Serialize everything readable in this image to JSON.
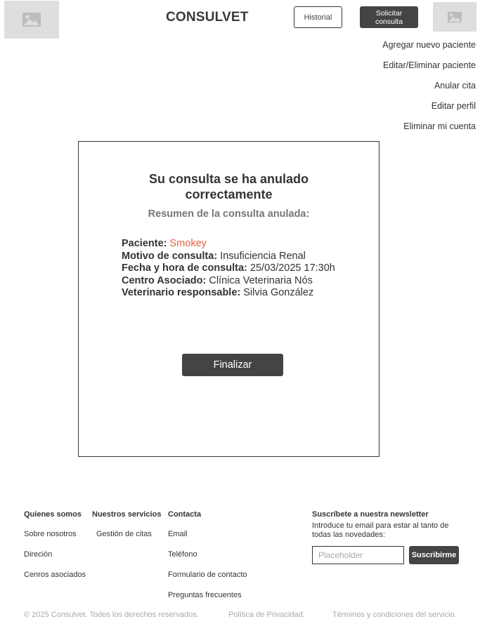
{
  "header": {
    "logo_icon": "image-placeholder-icon",
    "brand": "CONSULVET",
    "history_button": "Historial",
    "request_button": "Solicitar\nconsulta",
    "avatar_icon": "image-placeholder-icon"
  },
  "side_menu": {
    "items": [
      {
        "label": "Agregar nuevo paciente"
      },
      {
        "label": "Editar/Eliminar paciente"
      },
      {
        "label": "Anular cita"
      },
      {
        "label": "Editar perfil"
      },
      {
        "label": "Eliminar mi cuenta"
      }
    ]
  },
  "confirmation": {
    "title": "Su consulta se ha anulado correctamente",
    "subtitle": "Resumen de la consulta anulada:",
    "details": [
      {
        "label": "Paciente:",
        "value": "Smokey"
      },
      {
        "label": "Motivo de consulta:",
        "value": "Insuficiencia Renal"
      },
      {
        "label": "Fecha y hora de consulta:",
        "value": "25/03/2025 17:30h"
      },
      {
        "label": "Centro Asociado:",
        "value": "Clínica Veterinaria Nós"
      },
      {
        "label": "Veterinario responsable:",
        "value": "Silvia González"
      }
    ],
    "finish_button": "Finalizar"
  },
  "footer": {
    "about": {
      "title": "Quienes somos",
      "links": [
        "Sobre nosotros",
        "Direción",
        "Cenros asociados"
      ]
    },
    "services": {
      "title": "Nuestros servicios",
      "links": [
        "Gestión de citas"
      ]
    },
    "contact": {
      "title": "Contacta",
      "links": [
        "Email",
        "Teléfono",
        "Formulario de contacto",
        "Preguntas frecuentes"
      ]
    },
    "newsletter": {
      "title": "Suscríbete a nuestra newsletter",
      "text": "Introduce tu email para estar al tanto de todas las novedades:",
      "placeholder": "Placeholder",
      "button": "Suscribirme"
    },
    "copyright": "© 2025 Consulvet. Todos los derechos reservados.",
    "privacy": "Política de Privacidad.",
    "terms": "Términos y condiciones del servicio."
  },
  "colors": {
    "accent": "#e8603c",
    "dark_button": "#444444",
    "placeholder_bg": "#dedede"
  }
}
